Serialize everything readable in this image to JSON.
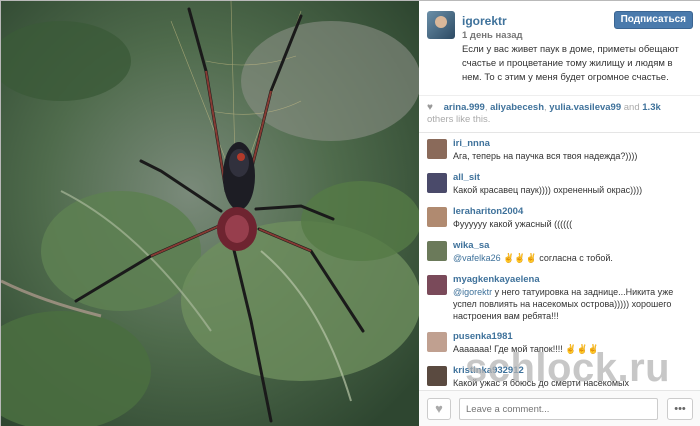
{
  "post": {
    "author": "igorektr",
    "follow_label": "Подписаться",
    "time": "1 день назад",
    "caption": "Если у вас живет паук в доме, приметы обещают счастье и процветание тому жилищу и людям в нем. То с этим у меня будет огромное счастье."
  },
  "likes": {
    "users": [
      "arina.999",
      "aliyabecesh",
      "yulia.vasileva99"
    ],
    "and_label": "and",
    "others_count": "1.3k",
    "others_label": "others like this."
  },
  "comments": [
    {
      "user": "iri_nnna",
      "text": "Ага, теперь на паучка вся твоя надежда?))))",
      "avatar_color": "#8a6a5a"
    },
    {
      "user": "all_sit",
      "text": "Какой красавец паук)))) охрененный окрас))))",
      "avatar_color": "#4a4a6a"
    },
    {
      "user": "lerahariton2004",
      "text": "Фуууууу какой ужасный ((((((",
      "avatar_color": "#b08a70"
    },
    {
      "user": "wika_sa",
      "mention": "@vafelka26",
      "text": " ✌✌✌ согласна с тобой.",
      "avatar_color": "#6b7a5a"
    },
    {
      "user": "myagkenkayaelena",
      "mention": "@igorektr",
      "text": " у него татуировка на заднице...Никита уже успел повлиять на насекомых острова))))) хорошего настроения вам ребята!!!",
      "avatar_color": "#7a4a5a"
    },
    {
      "user": "pusenka1981",
      "text": "Ааааааа! Где мой тапок!!!! ✌✌✌",
      "avatar_color": "#c0a090"
    },
    {
      "user": "kristinka932912",
      "text": "Какой ужас я боюсь до смерти насекомых",
      "avatar_color": "#5a4a40"
    }
  ],
  "footer": {
    "comment_placeholder": "Leave a comment...",
    "more_label": "•••"
  },
  "watermark": "schlock.ru",
  "icons": {
    "heart": "heart-icon",
    "more": "more-icon"
  }
}
